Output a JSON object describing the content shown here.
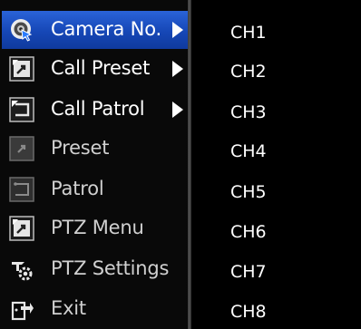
{
  "menu": {
    "items": [
      {
        "label": "Camera No.",
        "icon": "camera-number-icon",
        "active": true,
        "has_submenu": true
      },
      {
        "label": "Call Preset",
        "icon": "call-preset-icon",
        "active": false,
        "has_submenu": true
      },
      {
        "label": "Call Patrol",
        "icon": "call-patrol-icon",
        "active": false,
        "has_submenu": true
      },
      {
        "label": "Preset",
        "icon": "preset-icon",
        "active": false,
        "has_submenu": false
      },
      {
        "label": "Patrol",
        "icon": "patrol-icon",
        "active": false,
        "has_submenu": false
      },
      {
        "label": "PTZ Menu",
        "icon": "ptz-menu-icon",
        "active": false,
        "has_submenu": false
      },
      {
        "label": "PTZ Settings",
        "icon": "ptz-settings-icon",
        "active": false,
        "has_submenu": false
      },
      {
        "label": "Exit",
        "icon": "exit-icon",
        "active": false,
        "has_submenu": false
      }
    ]
  },
  "submenu": {
    "channels": [
      "CH1",
      "CH2",
      "CH3",
      "CH4",
      "CH5",
      "CH6",
      "CH7",
      "CH8"
    ]
  },
  "colors": {
    "active_highlight": "#1a4fc4",
    "background": "#000000",
    "text": "#ffffff"
  }
}
